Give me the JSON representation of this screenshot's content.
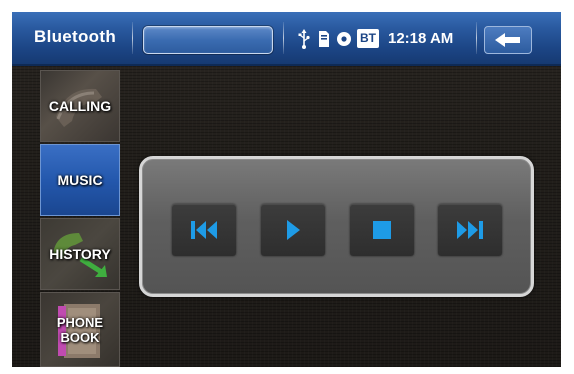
{
  "header": {
    "title": "Bluetooth",
    "search_field_value": "",
    "status": {
      "usb_icon": "usb-icon",
      "sd_card_icon": "sd-card-icon",
      "disc_icon": "disc-icon",
      "bt_badge": "BT"
    },
    "clock": "12:18 AM",
    "back_icon": "back-arrow-icon"
  },
  "sidebar": {
    "items": [
      {
        "label": "CALLING",
        "active": false
      },
      {
        "label": "MUSIC",
        "active": true
      },
      {
        "label": "HISTORY",
        "active": false
      },
      {
        "label": "PHONE\nBOOK",
        "active": false
      }
    ]
  },
  "player": {
    "controls": [
      {
        "icon": "previous-track-icon"
      },
      {
        "icon": "play-icon"
      },
      {
        "icon": "stop-icon"
      },
      {
        "icon": "next-track-icon"
      }
    ]
  },
  "colors": {
    "accent_blue": "#1e9be6",
    "header_blue": "#2a5aa0",
    "active_tab_blue": "#2458ad",
    "background": "#221f1b"
  }
}
